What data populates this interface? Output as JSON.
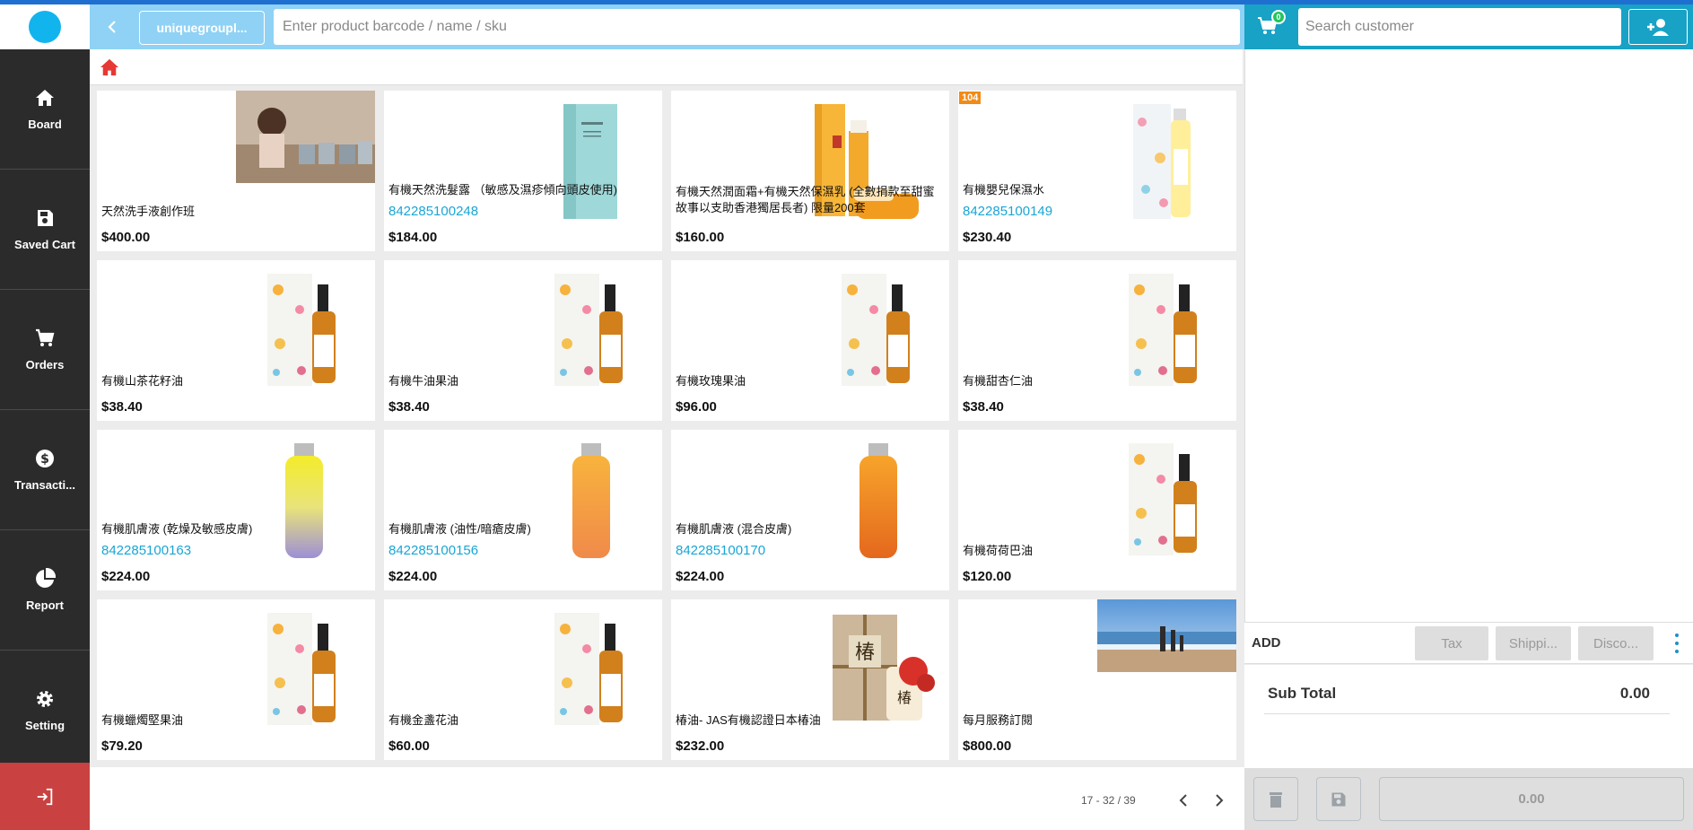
{
  "sidebar": {
    "items": [
      {
        "label": "Board",
        "icon": "home-icon"
      },
      {
        "label": "Saved Cart",
        "icon": "save-icon"
      },
      {
        "label": "Orders",
        "icon": "cart-icon"
      },
      {
        "label": "Transacti...",
        "icon": "dollar-icon"
      },
      {
        "label": "Report",
        "icon": "pie-chart-icon"
      },
      {
        "label": "Setting",
        "icon": "gear-icon"
      }
    ],
    "logout_icon": "logout-icon"
  },
  "topbar": {
    "group_label": "uniquegroupl...",
    "search_placeholder": "Enter product barcode / name / sku"
  },
  "products": [
    {
      "name": "天然洗手液創作班",
      "code": "",
      "price": "$400.00",
      "badge": "",
      "image": "photo-child"
    },
    {
      "name": "有機天然洗髮露 （敏感及濕疹傾向頭皮使用)",
      "code": "842285100248",
      "price": "$184.00",
      "badge": "",
      "image": "blue-box"
    },
    {
      "name": "有機天然潤面霜+有機天然保濕乳 (全數捐款至甜蜜故事以支助香港獨居長者) 限量200套",
      "code": "",
      "price": "$160.00",
      "badge": "",
      "image": "orange-set"
    },
    {
      "name": "有機嬰兒保濕水",
      "code": "842285100149",
      "price": "$230.40",
      "badge": "104",
      "image": "white-bottle"
    },
    {
      "name": "有機山茶花籽油",
      "code": "",
      "price": "$38.40",
      "badge": "",
      "image": "dropper"
    },
    {
      "name": "有機牛油果油",
      "code": "",
      "price": "$38.40",
      "badge": "",
      "image": "dropper"
    },
    {
      "name": "有機玫瑰果油",
      "code": "",
      "price": "$96.00",
      "badge": "",
      "image": "dropper"
    },
    {
      "name": "有機甜杏仁油",
      "code": "",
      "price": "$38.40",
      "badge": "",
      "image": "dropper"
    },
    {
      "name": "有機肌膚液 (乾燥及敏感皮膚)",
      "code": "842285100163",
      "price": "$224.00",
      "badge": "",
      "image": "purple-bottle"
    },
    {
      "name": "有機肌膚液 (油性/暗瘡皮膚)",
      "code": "842285100156",
      "price": "$224.00",
      "badge": "",
      "image": "orange-bottle"
    },
    {
      "name": "有機肌膚液 (混合皮膚)",
      "code": "842285100170",
      "price": "$224.00",
      "badge": "",
      "image": "amber-bottle"
    },
    {
      "name": "有機荷荷巴油",
      "code": "",
      "price": "$120.00",
      "badge": "",
      "image": "dropper"
    },
    {
      "name": "有機蠟燭堅果油",
      "code": "",
      "price": "$79.20",
      "badge": "",
      "image": "dropper"
    },
    {
      "name": "有機金盞花油",
      "code": "",
      "price": "$60.00",
      "badge": "",
      "image": "dropper"
    },
    {
      "name": "椿油- JAS有機認證日本椿油",
      "code": "",
      "price": "$232.00",
      "badge": "",
      "image": "gift-box"
    },
    {
      "name": "每月服務訂閱",
      "code": "",
      "price": "$800.00",
      "badge": "",
      "image": "beach-photo"
    }
  ],
  "pager": {
    "text": "17 - 32 / 39"
  },
  "cart": {
    "count": "0",
    "customer_placeholder": "Search customer",
    "add_label": "ADD",
    "tax_label": "Tax",
    "shipping_label": "Shippi...",
    "discount_label": "Disco...",
    "subtotal_label": "Sub Total",
    "subtotal_value": "0.00",
    "pay_value": "0.00"
  },
  "colors": {
    "sidebar": "#2b2b2b",
    "topbar": "#8fd2f5",
    "cart_header": "#17a2c6",
    "logout": "#c94141",
    "code_text": "#18a6d6",
    "home_icon": "#e53935"
  }
}
